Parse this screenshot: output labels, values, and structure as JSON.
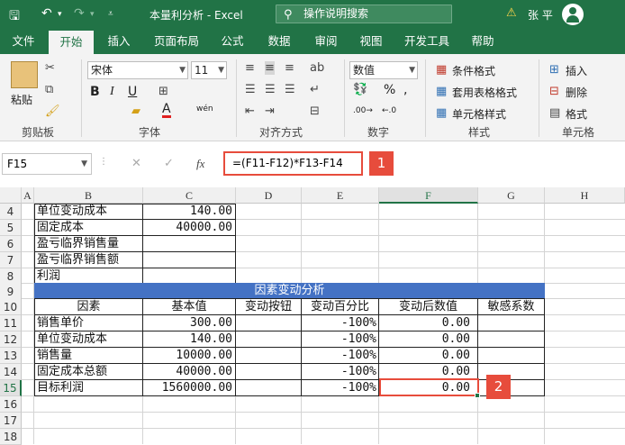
{
  "titlebar": {
    "title": "本量利分析 - Excel",
    "search_placeholder": "操作说明搜索",
    "user": "张 平",
    "warning": "⚠"
  },
  "tabs": [
    "文件",
    "开始",
    "插入",
    "页面布局",
    "公式",
    "数据",
    "审阅",
    "视图",
    "开发工具",
    "帮助"
  ],
  "ribbon": {
    "clipboard": {
      "paste": "粘贴",
      "label": "剪贴板"
    },
    "font": {
      "name": "宋体",
      "size": "11",
      "label": "字体",
      "wen": "wén"
    },
    "alignment": {
      "label": "对齐方式"
    },
    "number": {
      "format": "数值",
      "label": "数字"
    },
    "styles": {
      "conditional": "条件格式",
      "table": "套用表格格式",
      "cell": "单元格样式",
      "label": "样式"
    },
    "cells": {
      "insert": "插入",
      "delete": "删除",
      "format": "格式",
      "label": "单元格"
    }
  },
  "formula_bar": {
    "cell_ref": "F15",
    "formula": "=(F11-F12)*F13-F14",
    "fx": "fx",
    "badge1": "1"
  },
  "columns": [
    "A",
    "B",
    "C",
    "D",
    "E",
    "F",
    "G",
    "H"
  ],
  "rows": [
    "4",
    "5",
    "6",
    "7",
    "8",
    "9",
    "10",
    "11",
    "12",
    "13",
    "14",
    "15",
    "16",
    "17",
    "18"
  ],
  "cells": {
    "b4": "单位变动成本",
    "c4": "140.00",
    "b5": "固定成本",
    "c5": "40000.00",
    "b6": "盈亏临界销售量",
    "b7": "盈亏临界销售额",
    "b8": "利润",
    "title9": "因素变动分析",
    "h_factor": "因素",
    "h_base": "基本值",
    "h_btn": "变动按钮",
    "h_pct": "变动百分比",
    "h_after": "变动后数值",
    "h_sens": "敏感系数",
    "b11": "销售单价",
    "c11": "300.00",
    "e11": "-100%",
    "f11": "0.00",
    "b12": "单位变动成本",
    "c12": "140.00",
    "e12": "-100%",
    "f12": "0.00",
    "b13": "销售量",
    "c13": "10000.00",
    "e13": "-100%",
    "f13": "0.00",
    "b14": "固定成本总额",
    "c14": "40000.00",
    "e14": "-100%",
    "f14": "0.00",
    "b15": "目标利润",
    "c15": "1560000.00",
    "e15": "-100%",
    "f15": "0.00"
  },
  "badge2": "2",
  "colors": {
    "excel_green": "#217346",
    "header_band": "#4472c4",
    "highlight": "#e74c3c"
  }
}
